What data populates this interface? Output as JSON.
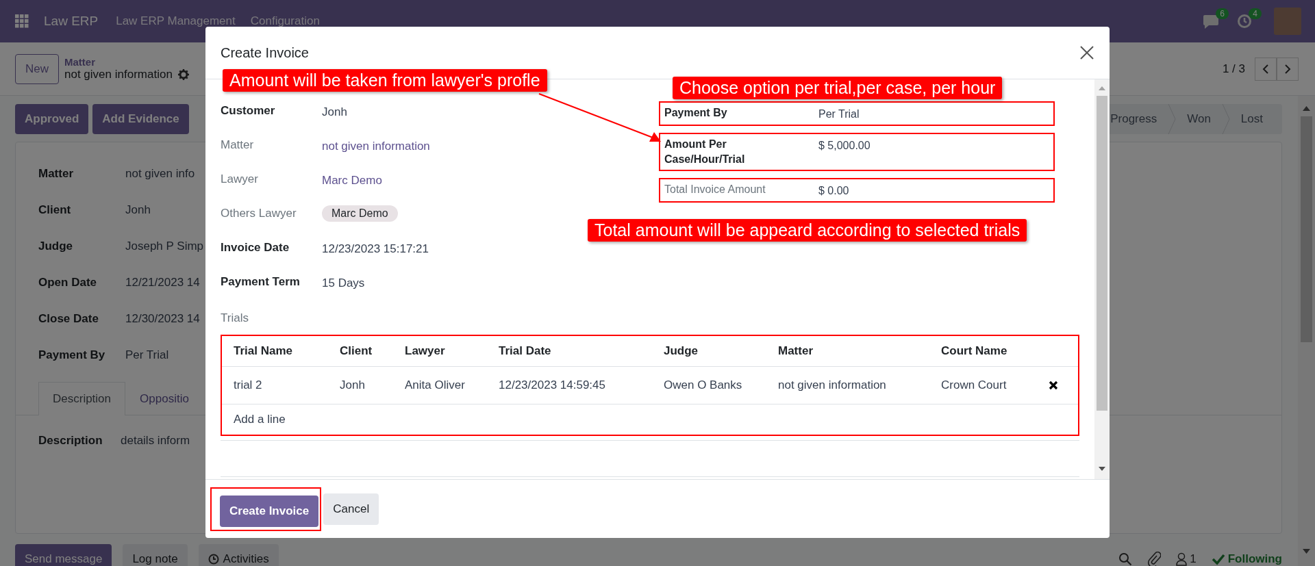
{
  "navbar": {
    "app_name": "Law ERP",
    "menus": [
      "Law ERP Management",
      "Configuration"
    ],
    "messages_count": "6",
    "activities_count": "4"
  },
  "control_panel": {
    "new_button": "New",
    "breadcrumb": "Matter",
    "record_name": "not given information",
    "pager": "1 / 3"
  },
  "action_buttons": [
    "Approved",
    "Add Evidence"
  ],
  "stages": [
    {
      "label": "Progress",
      "selected": false
    },
    {
      "label": "Won",
      "selected": false
    },
    {
      "label": "Lost",
      "selected": false
    }
  ],
  "sheet": {
    "fields": [
      {
        "label": "Matter",
        "value": "not given info"
      },
      {
        "label": "Client",
        "value": "Jonh"
      },
      {
        "label": "Judge",
        "value": "Joseph P Simp"
      },
      {
        "label": "Open Date",
        "value": "12/21/2023 14"
      },
      {
        "label": "Close Date",
        "value": "12/30/2023 14"
      },
      {
        "label": "Payment By",
        "value": "Per Trial"
      }
    ],
    "tabs": [
      {
        "label": "Description",
        "selected": true
      },
      {
        "label": "Oppositio",
        "selected": false
      }
    ],
    "description": {
      "label": "Description",
      "value": "details  inform"
    }
  },
  "chatter": {
    "buttons": [
      {
        "label": "Send message",
        "kind": "primary"
      },
      {
        "label": "Log note",
        "kind": "secondary"
      },
      {
        "label": "Activities",
        "kind": "activities"
      }
    ],
    "followers_count": "1",
    "follow_label": "Following"
  },
  "dialog": {
    "title": "Create Invoice",
    "left_fields": [
      {
        "label": "Customer",
        "value": "Jonh",
        "kind": "text",
        "emphasis": true
      },
      {
        "label": "Matter",
        "value": "not given information",
        "kind": "link",
        "emphasis": false
      },
      {
        "label": "Lawyer",
        "value": "Marc Demo",
        "kind": "link",
        "emphasis": false
      },
      {
        "label": "Others Lawyer",
        "value": "Marc Demo",
        "kind": "tag",
        "emphasis": false
      },
      {
        "label": "Invoice Date",
        "value": "12/23/2023 15:17:21",
        "kind": "text",
        "emphasis": true
      },
      {
        "label": "Payment Term",
        "value": "15 Days",
        "kind": "text",
        "emphasis": true
      }
    ],
    "right_fields": [
      {
        "label": "Payment By",
        "value": "Per Trial",
        "emphasis": true,
        "highlighted": true
      },
      {
        "label": "Amount Per Case/Hour/Trial",
        "value": "$ 5,000.00",
        "emphasis": true,
        "highlighted": true
      },
      {
        "label": "Total Invoice Amount",
        "value": "$ 0.00",
        "emphasis": false,
        "highlighted": true
      }
    ],
    "trials": {
      "label": "Trials",
      "highlighted": true,
      "columns": [
        "Trial Name",
        "Client",
        "Lawyer",
        "Trial Date",
        "Judge",
        "Matter",
        "Court Name"
      ],
      "rows": [
        [
          "trial 2",
          "Jonh",
          "Anita Oliver",
          "12/23/2023 14:59:45",
          "Owen O Banks",
          "not given information",
          "Crown Court"
        ]
      ],
      "add_line": "Add a line"
    },
    "buttons": [
      {
        "label": "Create Invoice",
        "kind": "primary",
        "highlighted": true
      },
      {
        "label": "Cancel",
        "kind": "secondary",
        "highlighted": false
      }
    ]
  },
  "annotations": [
    {
      "text": "Amount will be taken from lawyer's profle",
      "arrow": true
    },
    {
      "text": "Choose option per trial,per case, per hour",
      "arrow": false
    },
    {
      "text": "Total amount will be appeard according to selected trials",
      "arrow": false
    }
  ]
}
